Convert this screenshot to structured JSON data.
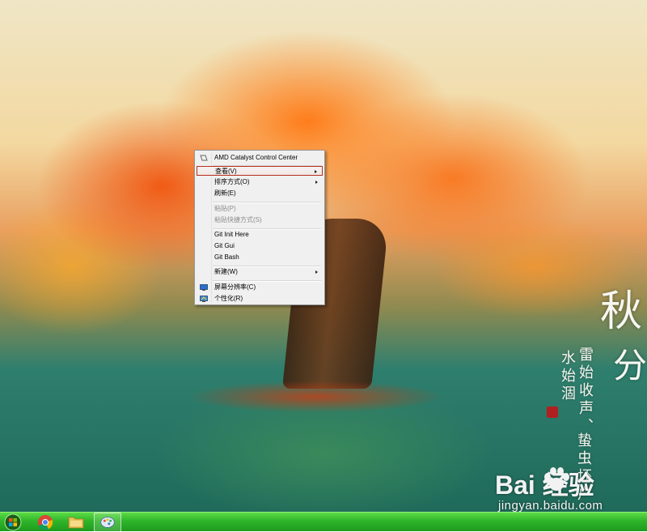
{
  "context_menu": {
    "items": [
      {
        "label": "AMD Catalyst Control Center",
        "icon": "amd-icon"
      },
      {
        "label": "查看(V)",
        "submenu": true,
        "highlighted": true
      },
      {
        "label": "排序方式(O)",
        "submenu": true
      },
      {
        "label": "刷新(E)"
      },
      {
        "label": "粘贴(P)",
        "disabled": true
      },
      {
        "label": "粘贴快捷方式(S)",
        "disabled": true
      },
      {
        "label": "Git Init Here"
      },
      {
        "label": "Git Gui"
      },
      {
        "label": "Git Bash"
      },
      {
        "label": "新建(W)",
        "submenu": true
      },
      {
        "label": "屏幕分辨率(C)",
        "icon": "monitor-icon"
      },
      {
        "label": "个性化(R)",
        "icon": "personalize-icon"
      }
    ]
  },
  "wallpaper": {
    "title_chars": [
      "秋",
      "分"
    ],
    "poem_columns": [
      "雷始收声、",
      "水始涸",
      "蛰虫坯户"
    ]
  },
  "watermark": {
    "brand_logo": "Bai 经验",
    "url": "jingyan.baidu.com"
  },
  "taskbar": {
    "pinned": [
      {
        "name": "chrome",
        "icon": "chrome-icon"
      },
      {
        "name": "explorer",
        "icon": "folder-icon"
      },
      {
        "name": "paint",
        "icon": "paint-icon",
        "active": true
      }
    ]
  },
  "colors": {
    "menu_highlight_border": "#b7301e",
    "taskbar_green": "#2fb52a"
  }
}
